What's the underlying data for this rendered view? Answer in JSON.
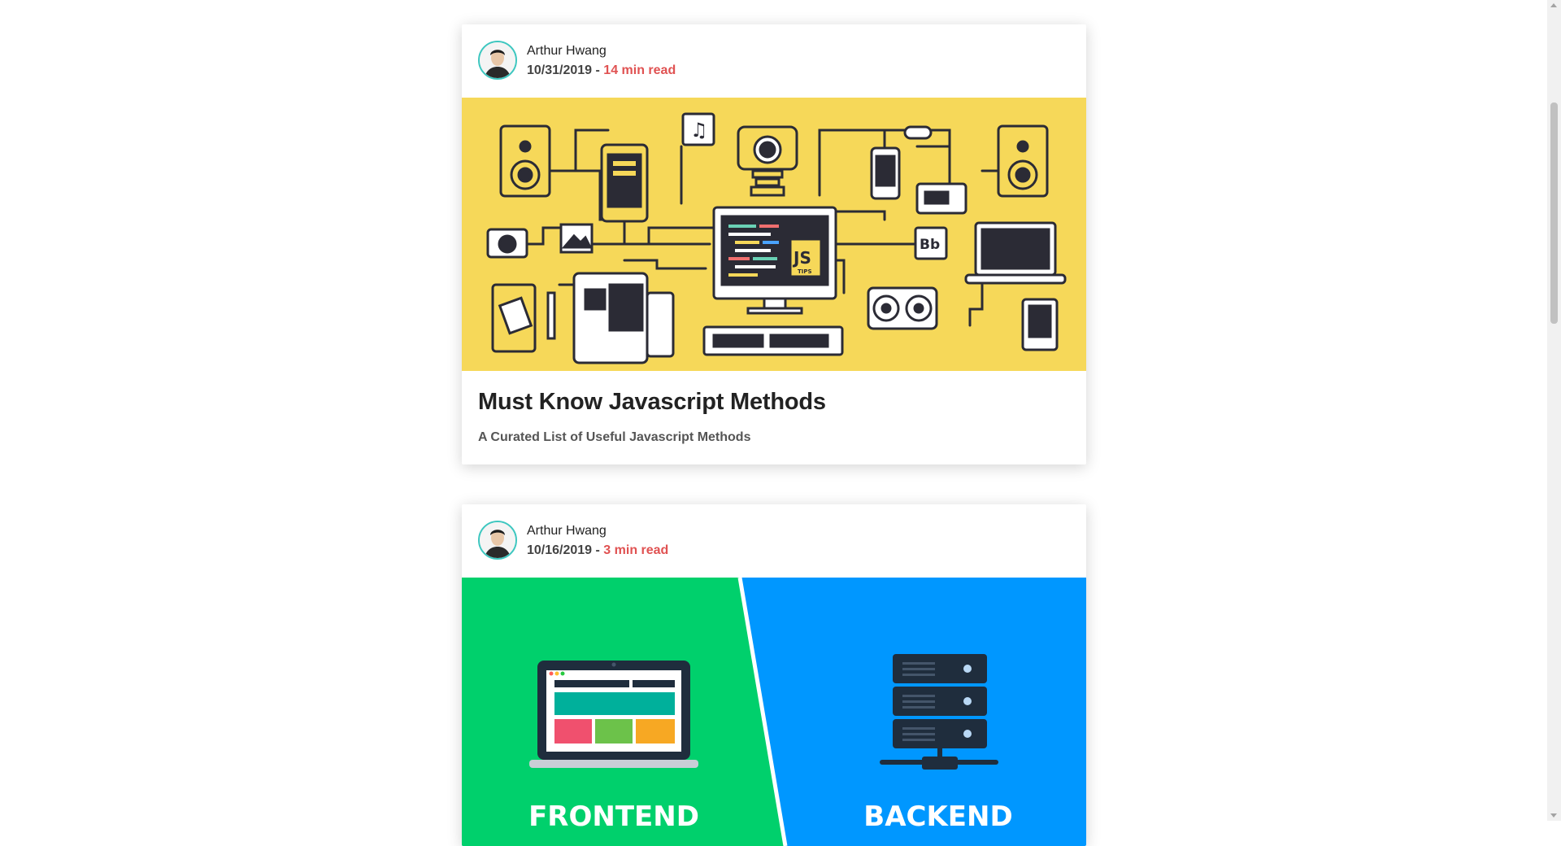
{
  "posts": [
    {
      "author": "Arthur Hwang",
      "date": "10/31/2019",
      "separator": " - ",
      "read_time": "14 min read",
      "title": "Must Know Javascript Methods",
      "subtitle": "A Curated List of Useful Javascript Methods",
      "hero": {
        "bg_color": "#f6d859",
        "icon": "javascript-devices-illustration",
        "screen_label": "JS",
        "screen_sublabel": "TIPS",
        "badge_label": "Bb"
      }
    },
    {
      "author": "Arthur Hwang",
      "date": "10/16/2019",
      "separator": " - ",
      "read_time": "3 min read",
      "hero": {
        "left_color": "#00d06c",
        "right_color": "#0097ff",
        "left_label": "FRONTEND",
        "right_label": "BACKEND",
        "left_icon": "laptop-icon",
        "right_icon": "server-icon"
      }
    }
  ],
  "colors": {
    "accent": "#e05252",
    "avatar_ring": "#3ec7c0"
  }
}
